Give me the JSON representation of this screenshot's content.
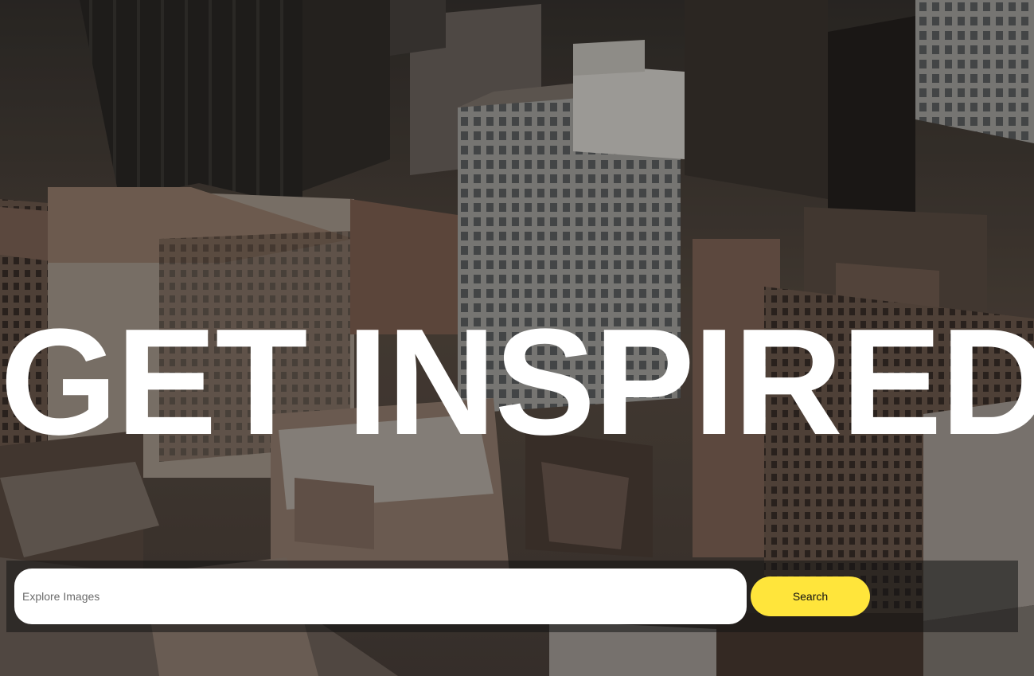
{
  "hero": {
    "headline": "GET INSPIRED",
    "background_image": "aerial city skyline"
  },
  "search": {
    "placeholder": "Explore Images",
    "value": "",
    "button_label": "Search"
  },
  "colors": {
    "accent": "#ffe53b",
    "headline": "#ffffff",
    "input_background": "#ffffff",
    "bar_overlay": "#141414"
  }
}
